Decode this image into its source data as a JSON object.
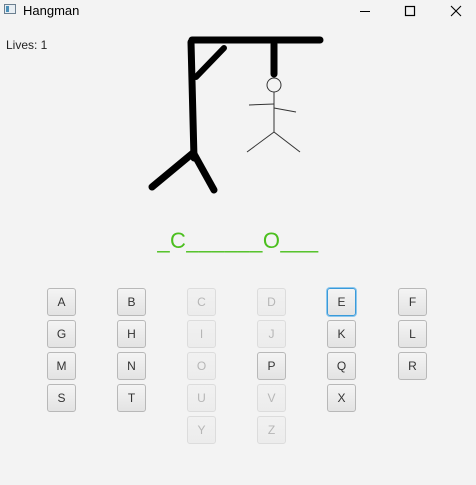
{
  "window": {
    "title": "Hangman"
  },
  "status": {
    "lives_text": "Lives: 1"
  },
  "word": {
    "display": "_C______O___"
  },
  "keyboard": {
    "rows": [
      [
        {
          "letter": "A",
          "state": "enabled"
        },
        {
          "letter": "B",
          "state": "enabled"
        },
        {
          "letter": "C",
          "state": "disabled"
        },
        {
          "letter": "D",
          "state": "disabled"
        },
        {
          "letter": "E",
          "state": "focused"
        },
        {
          "letter": "F",
          "state": "enabled"
        }
      ],
      [
        {
          "letter": "G",
          "state": "enabled"
        },
        {
          "letter": "H",
          "state": "enabled"
        },
        {
          "letter": "I",
          "state": "disabled"
        },
        {
          "letter": "J",
          "state": "disabled"
        },
        {
          "letter": "K",
          "state": "enabled"
        },
        {
          "letter": "L",
          "state": "enabled"
        }
      ],
      [
        {
          "letter": "M",
          "state": "enabled"
        },
        {
          "letter": "N",
          "state": "enabled"
        },
        {
          "letter": "O",
          "state": "disabled"
        },
        {
          "letter": "P",
          "state": "enabled"
        },
        {
          "letter": "Q",
          "state": "enabled"
        },
        {
          "letter": "R",
          "state": "enabled"
        }
      ],
      [
        {
          "letter": "S",
          "state": "enabled"
        },
        {
          "letter": "T",
          "state": "enabled"
        },
        {
          "letter": "U",
          "state": "disabled"
        },
        {
          "letter": "V",
          "state": "disabled"
        },
        {
          "letter": "X",
          "state": "enabled"
        }
      ],
      [
        null,
        null,
        {
          "letter": "Y",
          "state": "disabled"
        },
        {
          "letter": "Z",
          "state": "disabled"
        }
      ]
    ]
  },
  "icons": {
    "app": "app-window-icon",
    "minimize": "minimize-icon",
    "maximize": "maximize-icon",
    "close": "close-icon"
  },
  "colors": {
    "word": "#4bbf1e",
    "focus": "#3a9ad9"
  }
}
